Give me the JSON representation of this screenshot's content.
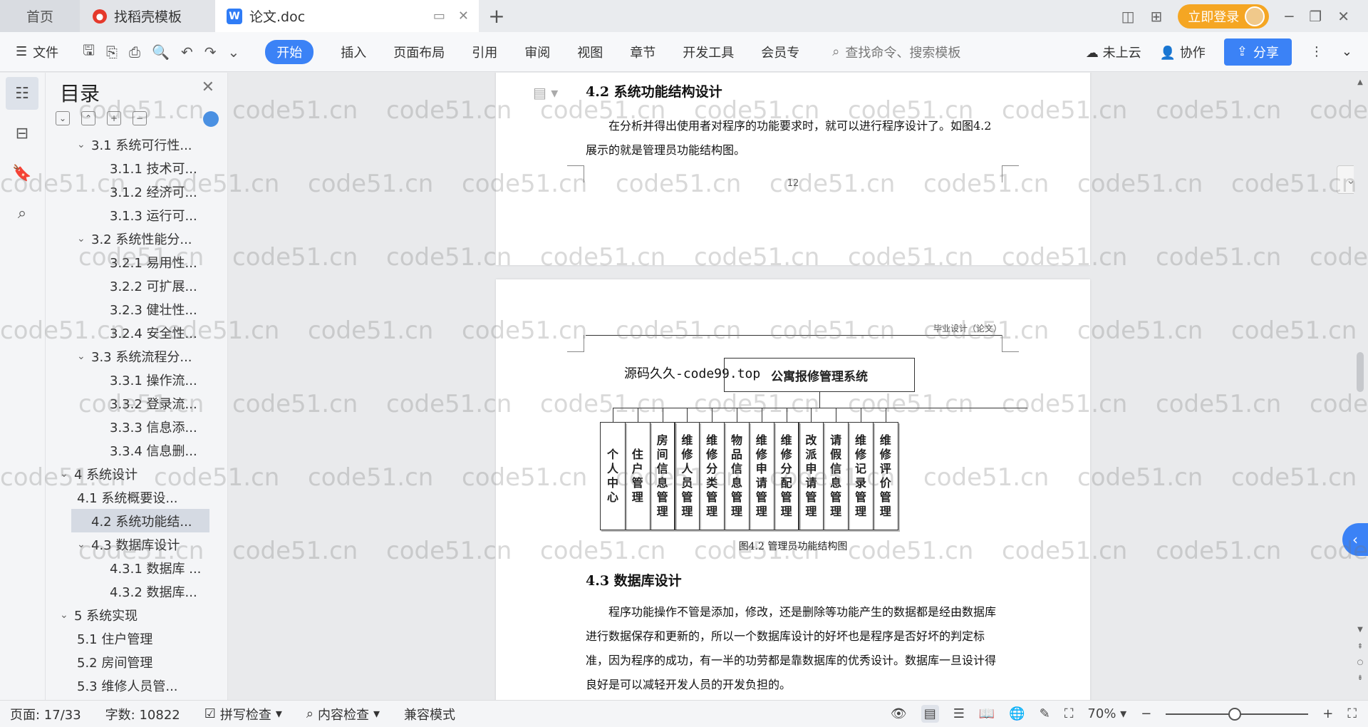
{
  "titlebar": {
    "tabs": [
      {
        "label": "首页"
      },
      {
        "label": "找稻壳模板"
      },
      {
        "label": "论文.doc"
      }
    ],
    "login_label": "立即登录"
  },
  "ribbon": {
    "menu_label": "文件",
    "tabs": [
      "开始",
      "插入",
      "页面布局",
      "引用",
      "审阅",
      "视图",
      "章节",
      "开发工具",
      "会员专"
    ],
    "search_placeholder": "查找命令、搜索模板",
    "cloud_label": "未上云",
    "collab_label": "协作",
    "share_label": "分享"
  },
  "toc": {
    "title": "目录",
    "items": [
      {
        "label": "3.1 系统可行性...",
        "level": 2,
        "caret": "⌄"
      },
      {
        "label": "3.1.1 技术可...",
        "level": 3
      },
      {
        "label": "3.1.2 经济可...",
        "level": 3
      },
      {
        "label": "3.1.3 运行可...",
        "level": 3
      },
      {
        "label": "3.2 系统性能分...",
        "level": 2,
        "caret": "⌄"
      },
      {
        "label": "3.2.1 易用性...",
        "level": 3
      },
      {
        "label": "3.2.2 可扩展...",
        "level": 3
      },
      {
        "label": "3.2.3 健壮性...",
        "level": 3
      },
      {
        "label": "3.2.4 安全性...",
        "level": 3
      },
      {
        "label": "3.3 系统流程分...",
        "level": 2,
        "caret": "⌄"
      },
      {
        "label": "3.3.1 操作流...",
        "level": 3
      },
      {
        "label": "3.3.2 登录流...",
        "level": 3
      },
      {
        "label": "3.3.3 信息添...",
        "level": 3
      },
      {
        "label": "3.3.4 信息删...",
        "level": 3
      },
      {
        "label": "4 系统设计",
        "level": 1,
        "caret": "⌄"
      },
      {
        "label": "4.1 系统概要设...",
        "level": 2
      },
      {
        "label": "4.2 系统功能结...",
        "level": 2,
        "selected": true
      },
      {
        "label": "4.3 数据库设计",
        "level": 2,
        "caret": "⌄"
      },
      {
        "label": "4.3.1 数据库 ...",
        "level": 3
      },
      {
        "label": "4.3.2 数据库...",
        "level": 3
      },
      {
        "label": "5 系统实现",
        "level": 1,
        "caret": "⌄"
      },
      {
        "label": "5.1 住户管理",
        "level": 2
      },
      {
        "label": "5.2 房间管理",
        "level": 2
      },
      {
        "label": "5.3 维修人员管...",
        "level": 2
      }
    ]
  },
  "document": {
    "page1": {
      "heading": "4.2  系统功能结构设计",
      "paragraph": "在分析并得出使用者对程序的功能要求时，就可以进行程序设计了。如图4.2 展示的就是管理员功能结构图。",
      "page_number": "12"
    },
    "page2": {
      "header_text": "毕业设计（论文）",
      "inline_watermark": "源码久久-code99.top",
      "org_root": "公寓报修管理系统",
      "org_children": [
        "个人中心",
        "住户管理",
        "房间信息管理",
        "维修人员管理",
        "维修分类管理",
        "物品信息管理",
        "维修申请管理",
        "维修分配管理",
        "改派申请管理",
        "请假信息管理",
        "维修记录管理",
        "维修评价管理"
      ],
      "caption": "图4.2  管理员功能结构图",
      "heading2": "4.3  数据库设计",
      "paragraph2": "程序功能操作不管是添加，修改，还是删除等功能产生的数据都是经由数据库进行数据保存和更新的，所以一个数据库设计的好坏也是程序是否好坏的判定标准，因为程序的成功，有一半的功劳都是靠数据库的优秀设计。数据库一旦设计得良好是可以减轻开发人员的开发负担的。"
    }
  },
  "statusbar": {
    "page": "页面: 17/33",
    "words": "字数: 10822",
    "spell": "拼写检查",
    "content_check": "内容检查",
    "compat": "兼容模式",
    "zoom": "70%"
  },
  "watermark_text": "code51.cn"
}
